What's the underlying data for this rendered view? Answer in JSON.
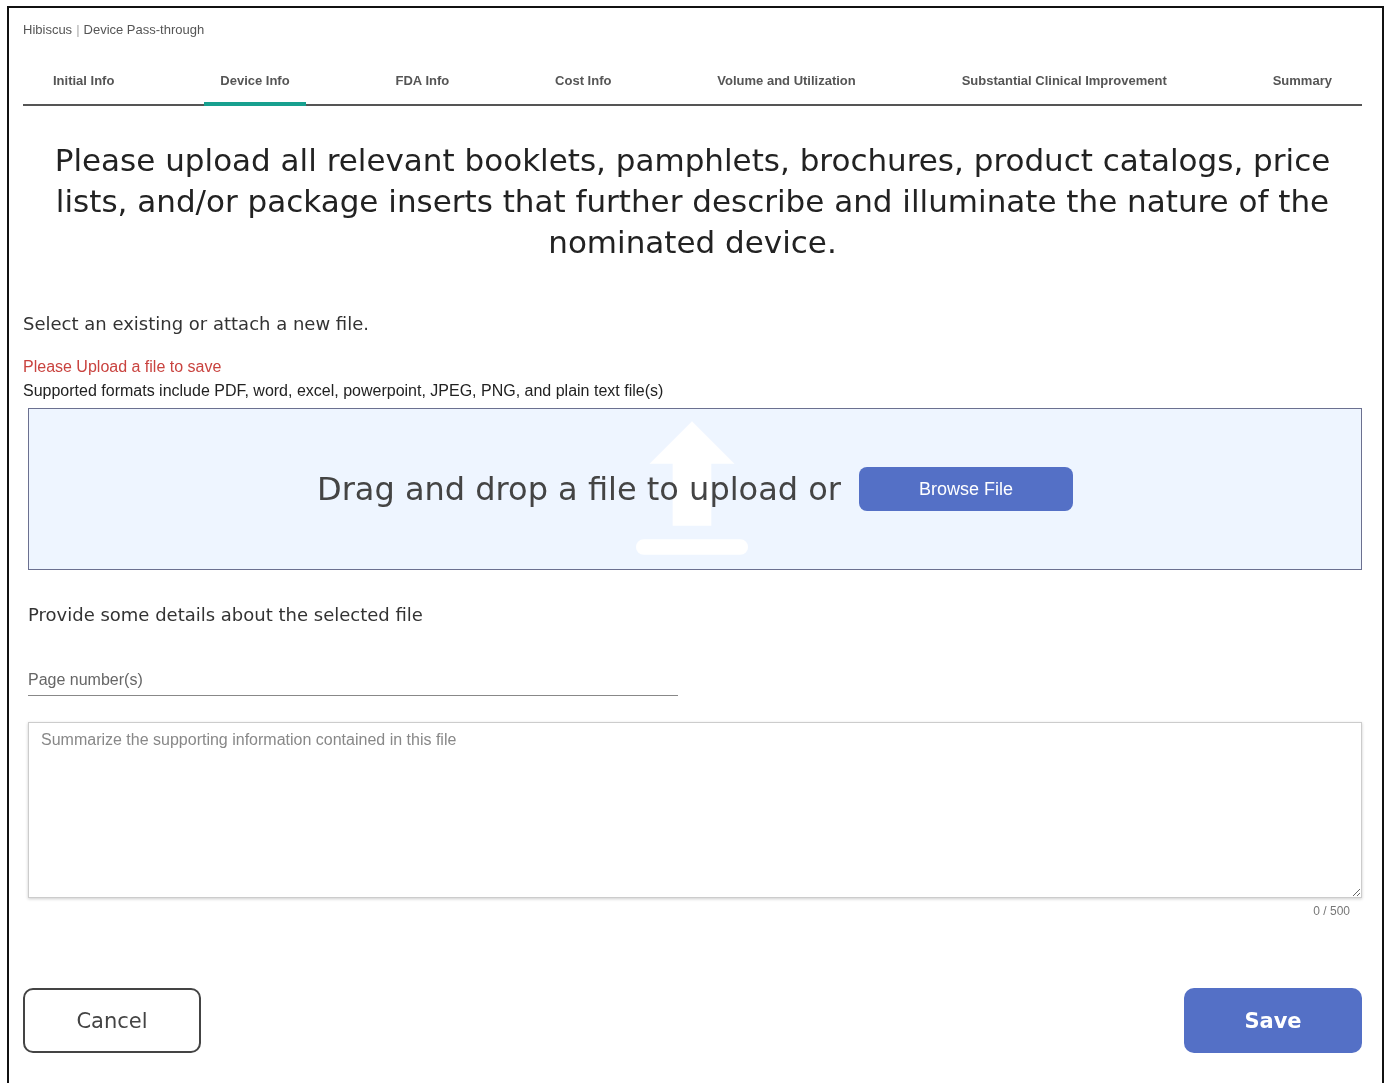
{
  "breadcrumb": {
    "app": "Hibiscus",
    "separator": "|",
    "page": "Device Pass-through"
  },
  "tabs": [
    {
      "label": "Initial Info",
      "selected": false
    },
    {
      "label": "Device Info",
      "selected": true
    },
    {
      "label": "FDA Info",
      "selected": false
    },
    {
      "label": "Cost Info",
      "selected": false
    },
    {
      "label": "Volume and Utilization",
      "selected": false
    },
    {
      "label": "Substantial Clinical Improvement",
      "selected": false
    },
    {
      "label": "Summary",
      "selected": false
    }
  ],
  "heading": "Please upload all relevant booklets, pamphlets, brochures, product catalogs, price lists, and/or package inserts that further describe and illuminate the nature of the nominated device.",
  "instruction": "Select an existing or attach a new file.",
  "error": "Please Upload a file to save",
  "formats_note": "Supported formats include PDF, word, excel, powerpoint, JPEG, PNG, and plain text file(s)",
  "dropzone": {
    "text": "Drag and drop a file to upload or",
    "button": "Browse File"
  },
  "details_label": "Provide some details about the selected file",
  "page_numbers": {
    "placeholder": "Page number(s)"
  },
  "summary": {
    "placeholder": "Summarize the supporting information contained in this file",
    "counter": "0 / 500"
  },
  "buttons": {
    "cancel": "Cancel",
    "save": "Save"
  }
}
